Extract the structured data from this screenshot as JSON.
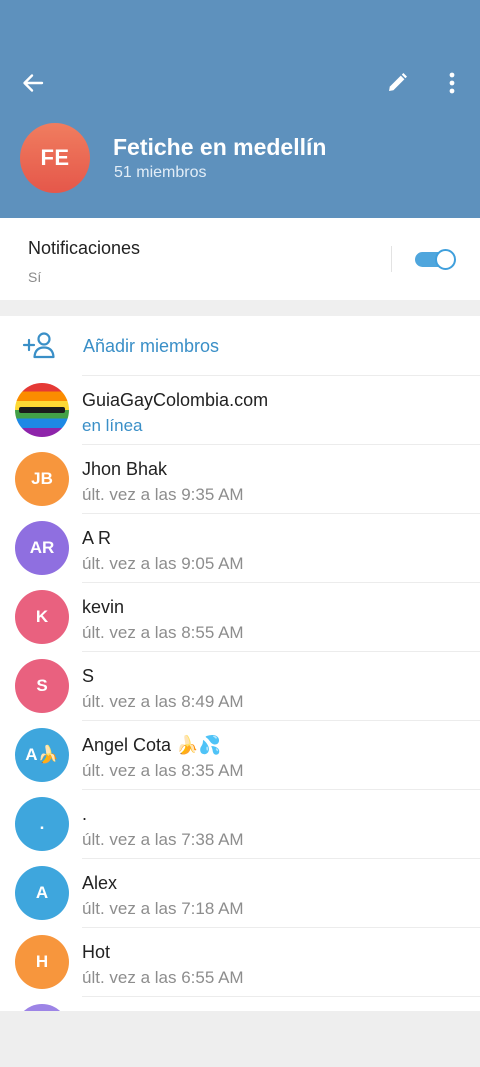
{
  "header": {
    "group_initials": "FE",
    "title": "Fetiche en medellín",
    "subtitle": "51 miembros",
    "icons": [
      "back-arrow-icon",
      "pencil-icon",
      "more-vertical-icon"
    ],
    "colors": {
      "header_bg": "#5e91bd",
      "avatar": "#e9604f"
    }
  },
  "notifications": {
    "label": "Notificaciones",
    "value": "Sí",
    "enabled": true,
    "accent": "#4fa6dd"
  },
  "add_members": {
    "label": "Añadir miembros",
    "icon": "add-user-icon"
  },
  "members": [
    {
      "initials": "",
      "name": "GuiaGayColombia.com",
      "status": "en línea",
      "online": true,
      "color": "rainbow"
    },
    {
      "initials": "JB",
      "name": "Jhon Bhak",
      "status": "últ. vez a las 9:35 AM",
      "online": false,
      "color": "#f7963d"
    },
    {
      "initials": "AR",
      "name": "A R",
      "status": "últ. vez a las 9:05 AM",
      "online": false,
      "color": "#8f6fe0"
    },
    {
      "initials": "K",
      "name": "kevin",
      "status": "últ. vez a las 8:55 AM",
      "online": false,
      "color": "#e9617f"
    },
    {
      "initials": "S",
      "name": "S",
      "status": "últ. vez a las 8:49 AM",
      "online": false,
      "color": "#e9617f"
    },
    {
      "initials": "A🍌",
      "name": "Angel Cota 🍌💦",
      "status": "últ. vez a las 8:35 AM",
      "online": false,
      "color": "#3ea6dd"
    },
    {
      "initials": ".",
      "name": ".",
      "status": "últ. vez a las 7:38 AM",
      "online": false,
      "color": "#3ea6dd"
    },
    {
      "initials": "A",
      "name": "Alex",
      "status": "últ. vez a las 7:18 AM",
      "online": false,
      "color": "#3ea6dd"
    },
    {
      "initials": "H",
      "name": "Hot",
      "status": "últ. vez a las 6:55 AM",
      "online": false,
      "color": "#f7963d"
    },
    {
      "initials": "",
      "name": "",
      "status": "",
      "online": false,
      "color": "#9d84e6"
    }
  ]
}
